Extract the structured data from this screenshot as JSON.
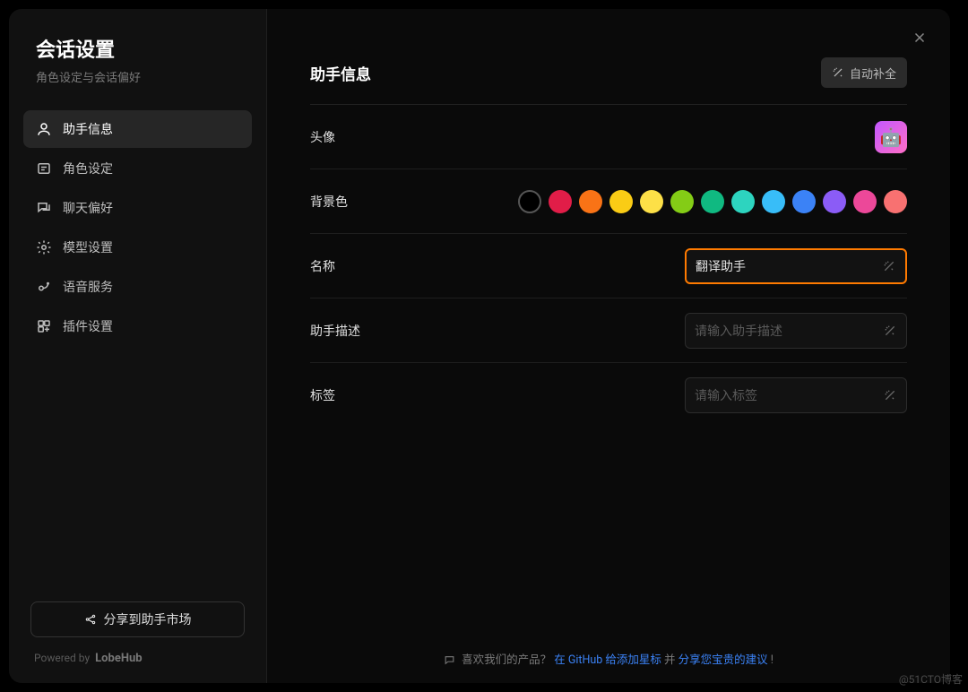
{
  "sidebar": {
    "title": "会话设置",
    "subtitle": "角色设定与会话偏好",
    "items": [
      {
        "label": "助手信息",
        "icon": "user"
      },
      {
        "label": "角色设定",
        "icon": "prompt"
      },
      {
        "label": "聊天偏好",
        "icon": "chat"
      },
      {
        "label": "模型设置",
        "icon": "gear"
      },
      {
        "label": "语音服务",
        "icon": "mic"
      },
      {
        "label": "插件设置",
        "icon": "plugin"
      }
    ],
    "share_label": "分享到助手市场",
    "powered_prefix": "Powered by",
    "powered_brand": "LobeHub"
  },
  "main": {
    "section_title": "助手信息",
    "auto_complete_label": "自动补全",
    "rows": {
      "avatar": {
        "label": "头像",
        "emoji": "🤖"
      },
      "bg_color": {
        "label": "背景色"
      },
      "name": {
        "label": "名称",
        "value": "翻译助手",
        "placeholder": ""
      },
      "description": {
        "label": "助手描述",
        "value": "",
        "placeholder": "请输入助手描述"
      },
      "tags": {
        "label": "标签",
        "value": "",
        "placeholder": "请输入标签"
      }
    },
    "colors": [
      "#000000",
      "#E11D48",
      "#F97316",
      "#FACC15",
      "#FDE047",
      "#84CC16",
      "#10B981",
      "#2DD4BF",
      "#38BDF8",
      "#3B82F6",
      "#8B5CF6",
      "#EC4899",
      "#F87171"
    ]
  },
  "footer": {
    "prefix": "喜欢我们的产品？",
    "text1": "在 GitHub 给添加星标",
    "mid": " 并 ",
    "text2": "分享您宝贵的建议",
    "suffix": " !"
  },
  "watermark": "@51CTO博客"
}
